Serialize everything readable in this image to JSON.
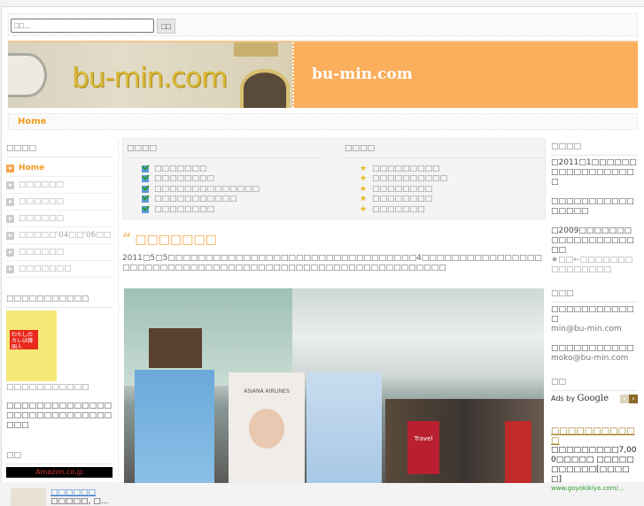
{
  "search": {
    "placeholder": "□□...",
    "button": "□□"
  },
  "header": {
    "title": "bu-min.com",
    "banner_logo": "bu-min.com"
  },
  "nav": {
    "home": "Home"
  },
  "left": {
    "menu_title": "□□□□",
    "menu": [
      "Home",
      "□□□□□□",
      "□□□□□□",
      "□□□□□□",
      "□□□□□'04□□'06□□",
      "□□□□□□",
      "□□□□□□□"
    ],
    "book_title": "□□□□□□□□□□□",
    "book_cover_text": "わたしのカレは韓国人",
    "book_caption": "□□□□□□□□□□□",
    "book_desc": "□□□□□□□□□□□□□□□□□□□□□□□□□□□□□□□",
    "ads_title": "□□",
    "amazon": "Amazon.co.jp",
    "amazon_item_link": "□□□□□□",
    "amazon_item_text": "□□□□□, □..."
  },
  "links": {
    "col1_title": "□□□□",
    "col1": [
      "□□□□□□□",
      "□□□□□□□□",
      "□□□□□□□□□□□□□□",
      "□□□□□□□□□□□",
      "□□□□□□□□"
    ],
    "col2_title": "□□□□",
    "col2": [
      "□□□□□□□□□",
      "□□□□□□□□□□",
      "□□□□□□□□",
      "□□□□□□□□",
      "□□□□□□□"
    ]
  },
  "post": {
    "title": "□□□□□□□",
    "body": "2011□5□5□□□□□□□□□□□□□□□□□□□□□□□□□□□□□□□□□4□□□□□□□□□□□□□□□□□□□□□□□□□□□□□□□□□□□□□□□□□□□□□□□□□□□□□□□□□□□",
    "photo_sign": "ASIANA AIRLINES",
    "photo_travel": "Travel"
  },
  "right": {
    "about_title": "□□□□",
    "about1": "□2011□1□□□□□□□□□□□□□□□□□□",
    "about2": "□□□□□□□□□□□□□□□□",
    "about3": "□2009□□□□□□□□□□□□□□□□□□□□",
    "about_note": "★□□←□□□□□□□□□□□□□□□",
    "contact_title": "□□□",
    "contact1": "□□□□□□□□□□□□",
    "mail1": "min@bu-min.com",
    "contact2": "□□□□□□□□□□□",
    "mail2": "moko@bu-min.com",
    "ads_title": "□□",
    "ads_by": "Ads by",
    "google": "Google",
    "ad_title": "□□□□□□□□□□□",
    "ad_text": "□□□□□□□□□7,000□□□□□ □□□□□□□□□□□[□□□□□]",
    "ad_url": "www.goyokikiya.com/..."
  },
  "colors": {
    "accent": "#f39a1e",
    "header_orange": "#fbae5c"
  }
}
